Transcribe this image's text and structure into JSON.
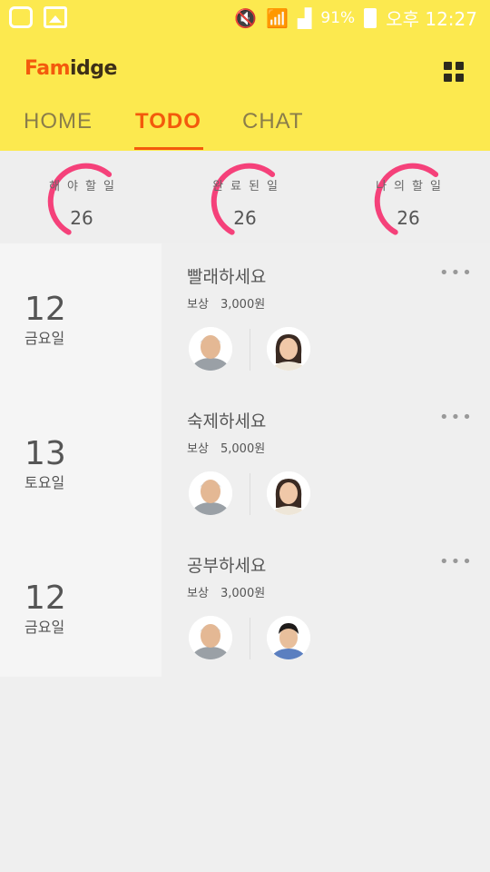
{
  "status_bar": {
    "battery_percent": "91%",
    "time": "오후 12:27",
    "icons": [
      "u-plus-icon",
      "gallery-icon",
      "mute-icon",
      "wifi-icon",
      "signal-icon",
      "battery-icon"
    ]
  },
  "header": {
    "logo_part1": "Fam",
    "logo_part2": "idge",
    "menu_icon": "grid-menu-icon",
    "accent_color": "#f35a0c",
    "bar_color": "#fce94f"
  },
  "tabs": [
    {
      "label": "HOME",
      "selected": false
    },
    {
      "label": "TODO",
      "selected": true
    },
    {
      "label": "CHAT",
      "selected": false
    }
  ],
  "stats": [
    {
      "label": "해야할일",
      "value": "26"
    },
    {
      "label": "완료된일",
      "value": "26"
    },
    {
      "label": "나의할일",
      "value": "26"
    }
  ],
  "todos": [
    {
      "day": "12",
      "weekday": "금요일",
      "title": "빨래하세요",
      "reward_label": "보상",
      "reward_value": "3,000원",
      "assigner_avatar": "grandfather-avatar",
      "assignee_avatar": "woman-avatar"
    },
    {
      "day": "13",
      "weekday": "토요일",
      "title": "숙제하세요",
      "reward_label": "보상",
      "reward_value": "5,000원",
      "assigner_avatar": "grandfather-avatar",
      "assignee_avatar": "woman-avatar"
    },
    {
      "day": "12",
      "weekday": "금요일",
      "title": "공부하세요",
      "reward_label": "보상",
      "reward_value": "3,000원",
      "assigner_avatar": "grandfather-avatar",
      "assignee_avatar": "young-man-avatar"
    }
  ]
}
